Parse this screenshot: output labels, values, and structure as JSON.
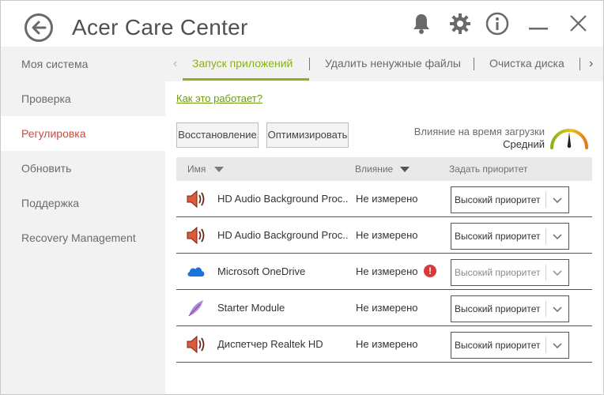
{
  "app": {
    "title": "Acer Care Center"
  },
  "sidebar": {
    "items": [
      {
        "label": "Моя система"
      },
      {
        "label": "Проверка"
      },
      {
        "label": "Регулировка"
      },
      {
        "label": "Обновить"
      },
      {
        "label": "Поддержка"
      },
      {
        "label": "Recovery Management"
      }
    ],
    "active_color": "#d0483b"
  },
  "tabs": {
    "items": [
      {
        "label": "Запуск приложений"
      },
      {
        "label": "Удалить ненужные файлы"
      },
      {
        "label": "Очистка диска"
      }
    ],
    "accent_color": "#8ab11b"
  },
  "main": {
    "how_link": "Как это работает?",
    "restore_button": "Восстановление",
    "optimize_button": "Оптимизировать",
    "impact_label": "Влияние на время загрузки",
    "impact_value": "Средний"
  },
  "table": {
    "headers": {
      "name": "Имя",
      "impact": "Влияние",
      "priority": "Задать приоритет"
    },
    "rows": [
      {
        "icon": "speaker-icon",
        "name": "HD Audio Background Proc..",
        "impact": "Не измерено",
        "warning": false,
        "priority": "Высокий приоритет",
        "disabled": false
      },
      {
        "icon": "speaker-icon",
        "name": "HD Audio Background Proc..",
        "impact": "Не измерено",
        "warning": false,
        "priority": "Высокий приоритет",
        "disabled": false
      },
      {
        "icon": "onedrive-cloud-icon",
        "name": "Microsoft OneDrive",
        "impact": "Не измерено",
        "warning": true,
        "warning_symbol": "!",
        "priority": "Высокий приоритет",
        "disabled": true
      },
      {
        "icon": "feather-icon",
        "name": "Starter Module",
        "impact": "Не измерено",
        "warning": false,
        "priority": "Высокий приоритет",
        "disabled": false
      },
      {
        "icon": "speaker-icon",
        "name": "Диспетчер Realtek HD",
        "impact": "Не измерено",
        "warning": false,
        "priority": "Высокий приоритет",
        "disabled": false
      }
    ]
  }
}
